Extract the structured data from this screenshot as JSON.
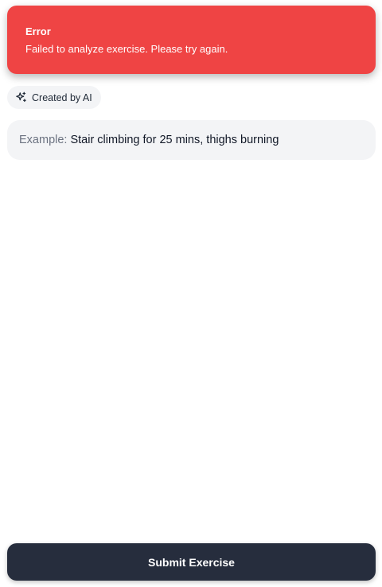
{
  "toast": {
    "title": "Error",
    "message": "Failed to analyze exercise. Please try again.",
    "color": "#ef4444"
  },
  "ai_badge": {
    "icon": "sparkles-icon",
    "label": "Created by AI"
  },
  "exercise_input": {
    "placeholder_prefix": "Example:",
    "placeholder_text": "Stair climbing for 25 mins, thighs burning"
  },
  "submit": {
    "label": "Submit Exercise",
    "color": "#262d3d"
  }
}
